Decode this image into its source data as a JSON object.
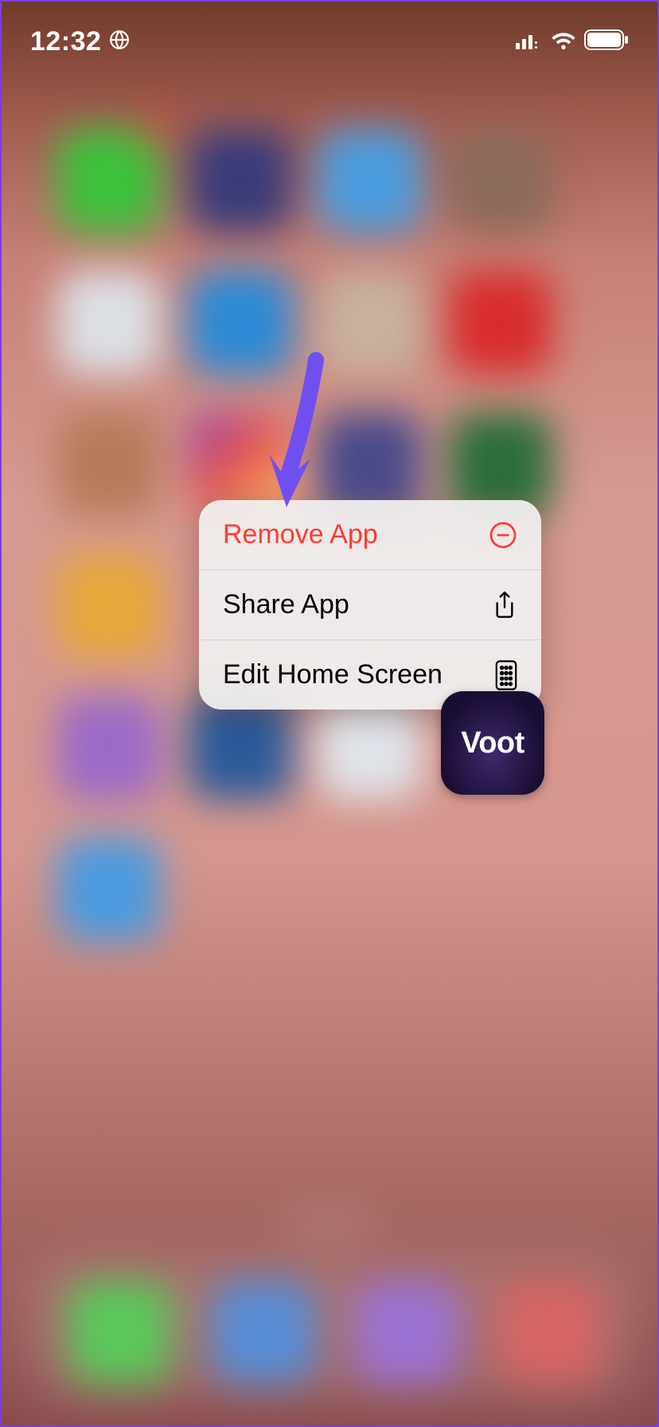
{
  "status_bar": {
    "time": "12:32"
  },
  "context_menu": {
    "items": [
      {
        "label": "Remove App",
        "style": "destructive",
        "icon": "minus-circle"
      },
      {
        "label": "Share App",
        "style": "normal",
        "icon": "share"
      },
      {
        "label": "Edit Home Screen",
        "style": "normal",
        "icon": "apps-grid"
      }
    ]
  },
  "app": {
    "name": "Voot"
  }
}
